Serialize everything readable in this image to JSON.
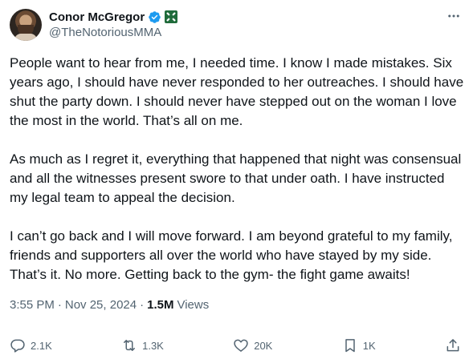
{
  "author": {
    "display_name": "Conor McGregor",
    "handle": "@TheNotoriousMMA",
    "verified_color": "#1d9bf0",
    "affiliation_color": "#1f6b3a"
  },
  "tweet": {
    "paragraphs": [
      "People want to hear from me, I needed time. I know I made mistakes. Six years ago, I should have never responded to her outreaches. I should have shut the party down. I should never have stepped out on the woman I love the most in the world. That’s all on me.",
      "As much as I regret it, everything that happened that night was consensual and all the witnesses present swore to that under oath. I have instructed my legal team to appeal the decision.",
      "I can’t go back and I will move forward. I am beyond grateful to my family, friends and supporters all over the world who have stayed by my side. That’s it. No more. Getting back to the gym- the fight game awaits!"
    ],
    "time": "3:55 PM",
    "date": "Nov 25, 2024",
    "separator": "·",
    "views_count": "1.5M",
    "views_label": "Views"
  },
  "actions": {
    "replies": "2.1K",
    "reposts": "1.3K",
    "likes": "20K",
    "bookmarks": "1K"
  },
  "icons": {
    "more": "more-horizontal-icon",
    "reply": "reply-icon",
    "repost": "repost-icon",
    "like": "heart-icon",
    "bookmark": "bookmark-icon",
    "share": "share-icon"
  }
}
